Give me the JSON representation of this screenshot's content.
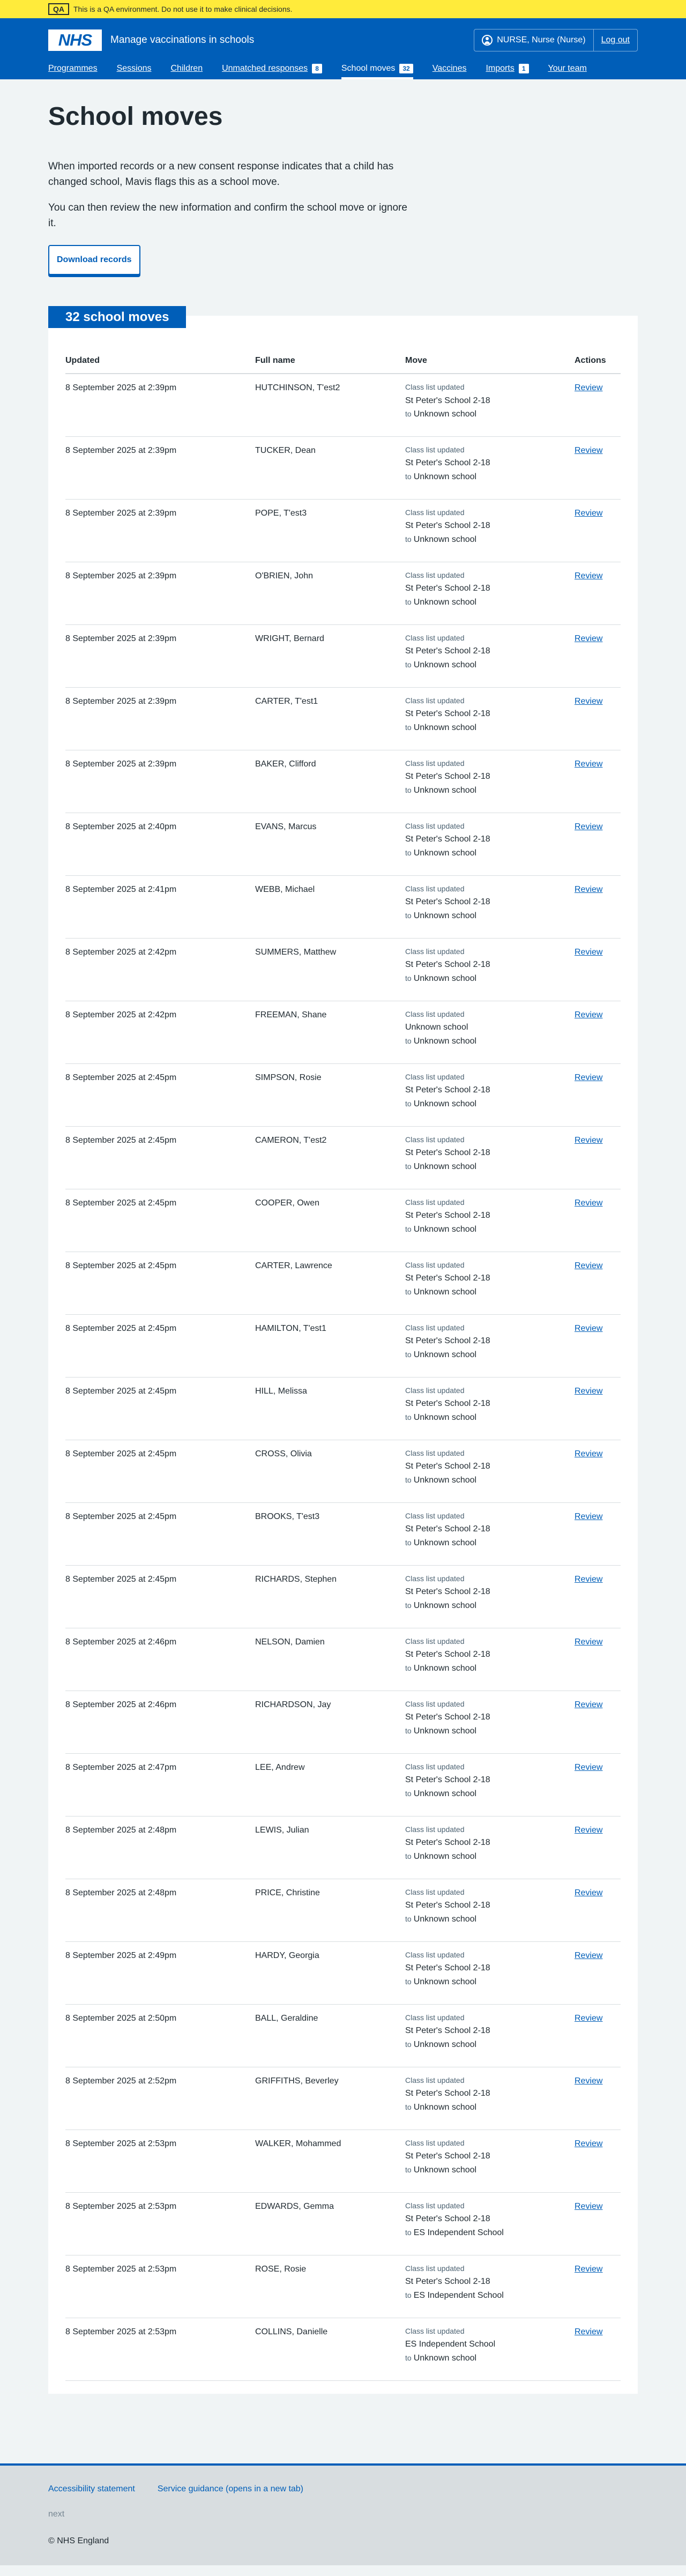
{
  "qa_banner": {
    "tag": "QA",
    "text": "This is a QA environment. Do not use it to make clinical decisions."
  },
  "header": {
    "logo_text": "NHS",
    "service_name": "Manage vaccinations in schools",
    "user_label": "NURSE, Nurse (Nurse)",
    "logout_label": "Log out"
  },
  "nav": [
    {
      "label": "Programmes",
      "count": null,
      "current": false
    },
    {
      "label": "Sessions",
      "count": null,
      "current": false
    },
    {
      "label": "Children",
      "count": null,
      "current": false
    },
    {
      "label": "Unmatched responses",
      "count": "8",
      "current": false
    },
    {
      "label": "School moves",
      "count": "32",
      "current": true
    },
    {
      "label": "Vaccines",
      "count": null,
      "current": false
    },
    {
      "label": "Imports",
      "count": "1",
      "current": false
    },
    {
      "label": "Your team",
      "count": null,
      "current": false
    }
  ],
  "page": {
    "title": "School moves",
    "intro_1": "When imported records or a new consent response indicates that a child has changed school, Mavis flags this as a school move.",
    "intro_2": "You can then review the new information and confirm the school move or ignore it.",
    "download_label": "Download records"
  },
  "table": {
    "heading": "32 school moves",
    "columns": {
      "updated": "Updated",
      "name": "Full name",
      "move": "Move",
      "actions": "Actions"
    },
    "to_word": "to",
    "review_label": "Review",
    "rows": [
      {
        "updated": "8 September 2025 at 2:39pm",
        "name": "HUTCHINSON, T'est2",
        "type": "Class list updated",
        "from": "St Peter's School 2-18",
        "to": "Unknown school"
      },
      {
        "updated": "8 September 2025 at 2:39pm",
        "name": "TUCKER, Dean",
        "type": "Class list updated",
        "from": "St Peter's School 2-18",
        "to": "Unknown school"
      },
      {
        "updated": "8 September 2025 at 2:39pm",
        "name": "POPE, T'est3",
        "type": "Class list updated",
        "from": "St Peter's School 2-18",
        "to": "Unknown school"
      },
      {
        "updated": "8 September 2025 at 2:39pm",
        "name": "O'BRIEN, John",
        "type": "Class list updated",
        "from": "St Peter's School 2-18",
        "to": "Unknown school"
      },
      {
        "updated": "8 September 2025 at 2:39pm",
        "name": "WRIGHT, Bernard",
        "type": "Class list updated",
        "from": "St Peter's School 2-18",
        "to": "Unknown school"
      },
      {
        "updated": "8 September 2025 at 2:39pm",
        "name": "CARTER, T'est1",
        "type": "Class list updated",
        "from": "St Peter's School 2-18",
        "to": "Unknown school"
      },
      {
        "updated": "8 September 2025 at 2:39pm",
        "name": "BAKER, Clifford",
        "type": "Class list updated",
        "from": "St Peter's School 2-18",
        "to": "Unknown school"
      },
      {
        "updated": "8 September 2025 at 2:40pm",
        "name": "EVANS, Marcus",
        "type": "Class list updated",
        "from": "St Peter's School 2-18",
        "to": "Unknown school"
      },
      {
        "updated": "8 September 2025 at 2:41pm",
        "name": "WEBB, Michael",
        "type": "Class list updated",
        "from": "St Peter's School 2-18",
        "to": "Unknown school"
      },
      {
        "updated": "8 September 2025 at 2:42pm",
        "name": "SUMMERS, Matthew",
        "type": "Class list updated",
        "from": "St Peter's School 2-18",
        "to": "Unknown school"
      },
      {
        "updated": "8 September 2025 at 2:42pm",
        "name": "FREEMAN, Shane",
        "type": "Class list updated",
        "from": "Unknown school",
        "to": "Unknown school"
      },
      {
        "updated": "8 September 2025 at 2:45pm",
        "name": "SIMPSON, Rosie",
        "type": "Class list updated",
        "from": "St Peter's School 2-18",
        "to": "Unknown school"
      },
      {
        "updated": "8 September 2025 at 2:45pm",
        "name": "CAMERON, T'est2",
        "type": "Class list updated",
        "from": "St Peter's School 2-18",
        "to": "Unknown school"
      },
      {
        "updated": "8 September 2025 at 2:45pm",
        "name": "COOPER, Owen",
        "type": "Class list updated",
        "from": "St Peter's School 2-18",
        "to": "Unknown school"
      },
      {
        "updated": "8 September 2025 at 2:45pm",
        "name": "CARTER, Lawrence",
        "type": "Class list updated",
        "from": "St Peter's School 2-18",
        "to": "Unknown school"
      },
      {
        "updated": "8 September 2025 at 2:45pm",
        "name": "HAMILTON, T'est1",
        "type": "Class list updated",
        "from": "St Peter's School 2-18",
        "to": "Unknown school"
      },
      {
        "updated": "8 September 2025 at 2:45pm",
        "name": "HILL, Melissa",
        "type": "Class list updated",
        "from": "St Peter's School 2-18",
        "to": "Unknown school"
      },
      {
        "updated": "8 September 2025 at 2:45pm",
        "name": "CROSS, Olivia",
        "type": "Class list updated",
        "from": "St Peter's School 2-18",
        "to": "Unknown school"
      },
      {
        "updated": "8 September 2025 at 2:45pm",
        "name": "BROOKS, T'est3",
        "type": "Class list updated",
        "from": "St Peter's School 2-18",
        "to": "Unknown school"
      },
      {
        "updated": "8 September 2025 at 2:45pm",
        "name": "RICHARDS, Stephen",
        "type": "Class list updated",
        "from": "St Peter's School 2-18",
        "to": "Unknown school"
      },
      {
        "updated": "8 September 2025 at 2:46pm",
        "name": "NELSON, Damien",
        "type": "Class list updated",
        "from": "St Peter's School 2-18",
        "to": "Unknown school"
      },
      {
        "updated": "8 September 2025 at 2:46pm",
        "name": "RICHARDSON, Jay",
        "type": "Class list updated",
        "from": "St Peter's School 2-18",
        "to": "Unknown school"
      },
      {
        "updated": "8 September 2025 at 2:47pm",
        "name": "LEE, Andrew",
        "type": "Class list updated",
        "from": "St Peter's School 2-18",
        "to": "Unknown school"
      },
      {
        "updated": "8 September 2025 at 2:48pm",
        "name": "LEWIS, Julian",
        "type": "Class list updated",
        "from": "St Peter's School 2-18",
        "to": "Unknown school"
      },
      {
        "updated": "8 September 2025 at 2:48pm",
        "name": "PRICE, Christine",
        "type": "Class list updated",
        "from": "St Peter's School 2-18",
        "to": "Unknown school"
      },
      {
        "updated": "8 September 2025 at 2:49pm",
        "name": "HARDY, Georgia",
        "type": "Class list updated",
        "from": "St Peter's School 2-18",
        "to": "Unknown school"
      },
      {
        "updated": "8 September 2025 at 2:50pm",
        "name": "BALL, Geraldine",
        "type": "Class list updated",
        "from": "St Peter's School 2-18",
        "to": "Unknown school"
      },
      {
        "updated": "8 September 2025 at 2:52pm",
        "name": "GRIFFITHS, Beverley",
        "type": "Class list updated",
        "from": "St Peter's School 2-18",
        "to": "Unknown school"
      },
      {
        "updated": "8 September 2025 at 2:53pm",
        "name": "WALKER, Mohammed",
        "type": "Class list updated",
        "from": "St Peter's School 2-18",
        "to": "Unknown school"
      },
      {
        "updated": "8 September 2025 at 2:53pm",
        "name": "EDWARDS, Gemma",
        "type": "Class list updated",
        "from": "St Peter's School 2-18",
        "to": "ES Independent School"
      },
      {
        "updated": "8 September 2025 at 2:53pm",
        "name": "ROSE, Rosie",
        "type": "Class list updated",
        "from": "St Peter's School 2-18",
        "to": "ES Independent School"
      },
      {
        "updated": "8 September 2025 at 2:53pm",
        "name": "COLLINS, Danielle",
        "type": "Class list updated",
        "from": "ES Independent School",
        "to": "Unknown school"
      }
    ]
  },
  "footer": {
    "links": [
      "Accessibility statement",
      "Service guidance (opens in a new tab)"
    ],
    "next_label": "next",
    "copyright": "© NHS England"
  },
  "colors": {
    "brand": "#005eb8",
    "qa_banner": "#ffeb3b",
    "page_bg": "#f0f4f5"
  }
}
